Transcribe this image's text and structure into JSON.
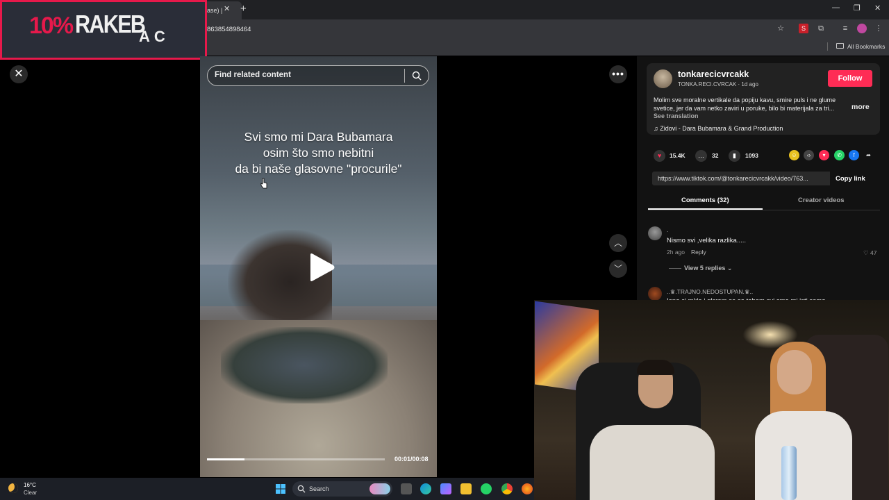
{
  "browser": {
    "tab_title": "ase) |",
    "url": "863854898464",
    "bookmarks_label": "All Bookmarks"
  },
  "overlay": {
    "promo_percent": "10%",
    "promo_word": "RAKEB",
    "promo_tail": "AC"
  },
  "video": {
    "search_placeholder": "Find related content",
    "caption_lines": [
      "Svi smo mi Dara Bubamara",
      "osim što smo nebitni",
      "da bi naše glasovne \"procurile\""
    ],
    "time": "00:01/00:08",
    "progress_fraction": 0.21
  },
  "creator": {
    "username": "tonkarecicvrcakk",
    "handle_line": "TONKA.RECI.CVRCAK · 1d ago",
    "follow_label": "Follow",
    "description": "Molim sve moralne vertikale da popiju kavu, smire puls i ne glume svetice, jer da vam netko zaviri u poruke, bilo bi materijala za tri...",
    "more_label": "more",
    "see_translation": "See translation",
    "music": "Zidovi - Dara Bubamara & Grand Production"
  },
  "stats": {
    "likes": "15.4K",
    "comments": "32",
    "saves": "1093"
  },
  "share": {
    "link": "https://www.tiktok.com/@tonkarecicvrcakk/video/763...",
    "copy_label": "Copy link"
  },
  "tabs": {
    "comments": "Comments (32)",
    "creator_videos": "Creator videos"
  },
  "comments": [
    {
      "name": ".",
      "text": "Nismo svi ,velika razlika.....",
      "time": "2h ago",
      "reply": "Reply",
      "likes": "47",
      "view_replies": "View 5 replies"
    },
    {
      "name": "..♛.TRAJNO.NEDOSTUPAN.♛..",
      "text": "Iano ci mklo i glsram se so tobom svi smo mi isti samo..."
    }
  ],
  "taskbar": {
    "temp": "16°C",
    "condition": "Clear",
    "search_label": "Search"
  },
  "colors": {
    "accent_follow": "#fe2c55",
    "promo_red": "#e6194b"
  }
}
